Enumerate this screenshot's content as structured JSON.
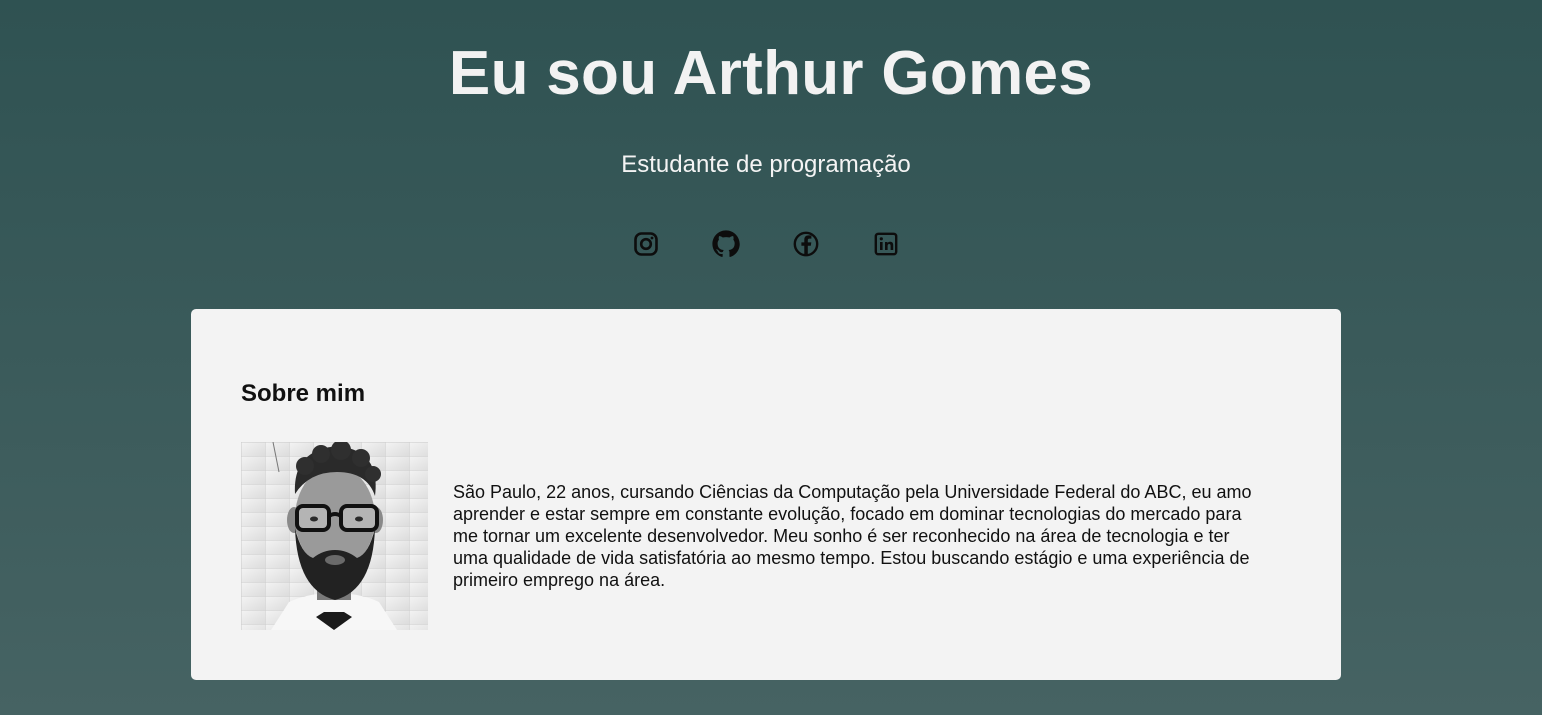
{
  "header": {
    "title": "Eu sou Arthur Gomes",
    "subtitle": "Estudante de programação"
  },
  "social": [
    {
      "icon": "instagram-icon"
    },
    {
      "icon": "github-icon"
    },
    {
      "icon": "facebook-icon"
    },
    {
      "icon": "linkedin-icon"
    }
  ],
  "about": {
    "title": "Sobre mim",
    "text": "São Paulo, 22 anos, cursando Ciências da Computação pela Universidade Federal do ABC, eu amo aprender e estar sempre em constante evolução, focado em dominar tecnologias do mercado para me tornar um excelente desenvolvedor. Meu sonho é ser reconhecido na área de tecnologia e ter uma qualidade de vida satisfatória ao mesmo tempo. Estou buscando estágio e uma experiência de primeiro emprego na área."
  },
  "colors": {
    "background_top": "#2f5252",
    "background_bottom": "#466363",
    "card": "#f3f3f3",
    "text_light": "#f2f2f2"
  }
}
